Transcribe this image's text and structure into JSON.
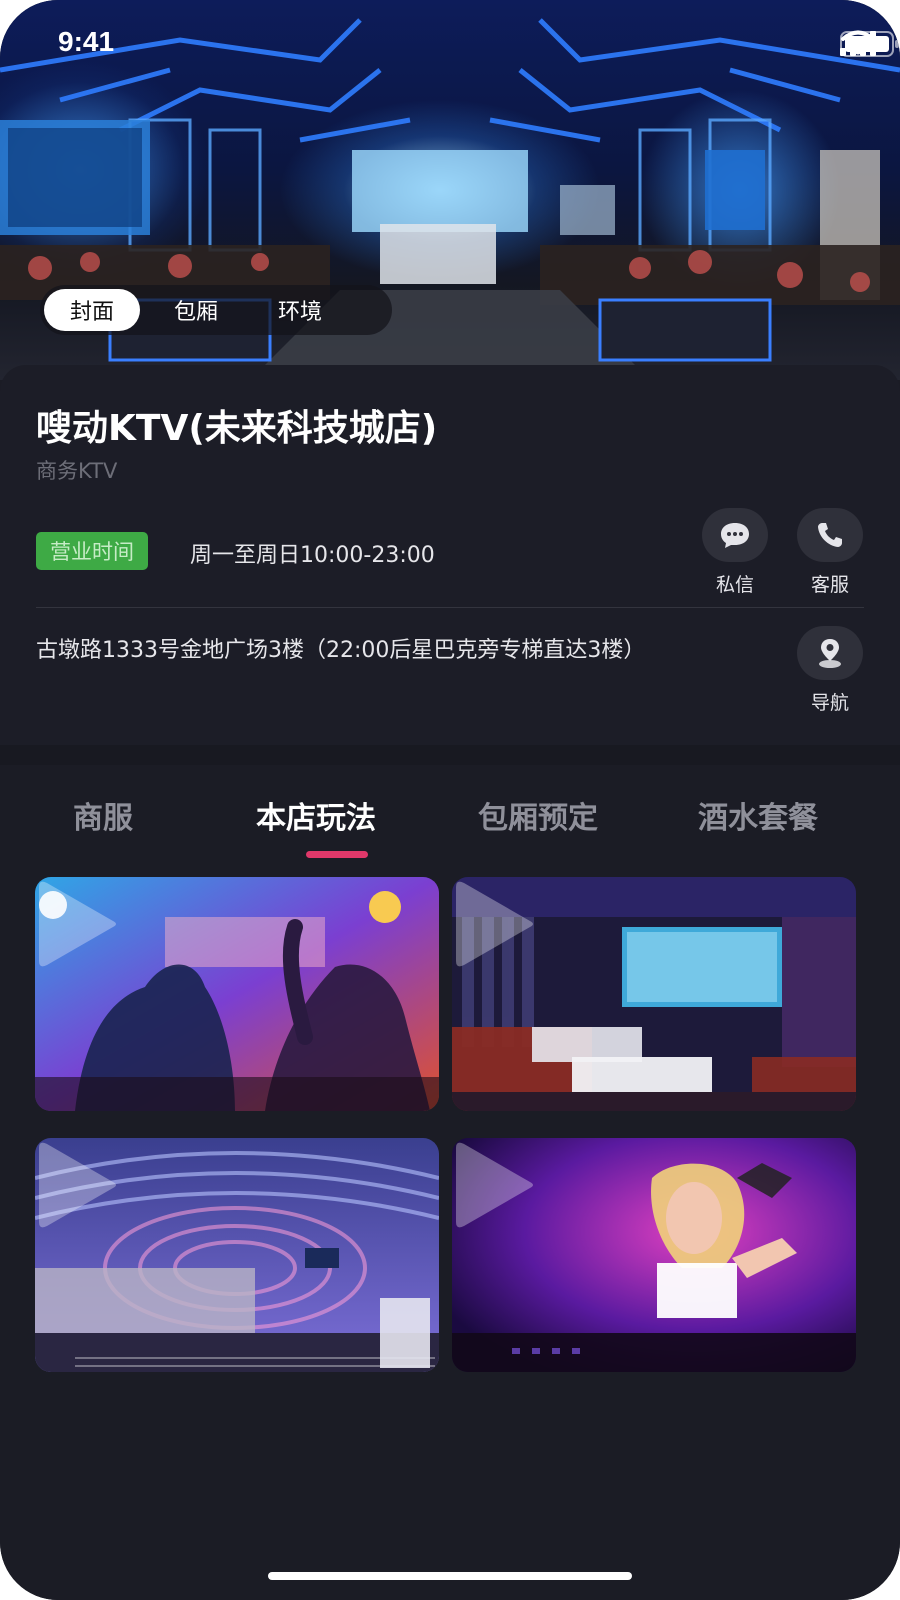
{
  "status": {
    "time": "9:41"
  },
  "cover_tabs": [
    {
      "label": "封面",
      "active": true
    },
    {
      "label": "包厢",
      "active": false
    },
    {
      "label": "环境",
      "active": false
    }
  ],
  "shop": {
    "name": "嗖动KTV(未来科技城店)",
    "type": "商务KTV",
    "hours_label": "营业时间",
    "hours": "周一至周日10:00-23:00",
    "address": "古墩路1333号金地广场3楼（22:00后星巴克旁专梯直达3楼）"
  },
  "actions": {
    "message": "私信",
    "service": "客服",
    "navigate": "导航"
  },
  "main_tabs": [
    {
      "label": "商服",
      "active": false
    },
    {
      "label": "本店玩法",
      "active": true
    },
    {
      "label": "包厢预定",
      "active": false
    },
    {
      "label": "酒水套餐",
      "active": false
    }
  ],
  "colors": {
    "accent": "#e0386a",
    "badge_green": "#3eaa45",
    "background": "#1b1c25"
  }
}
